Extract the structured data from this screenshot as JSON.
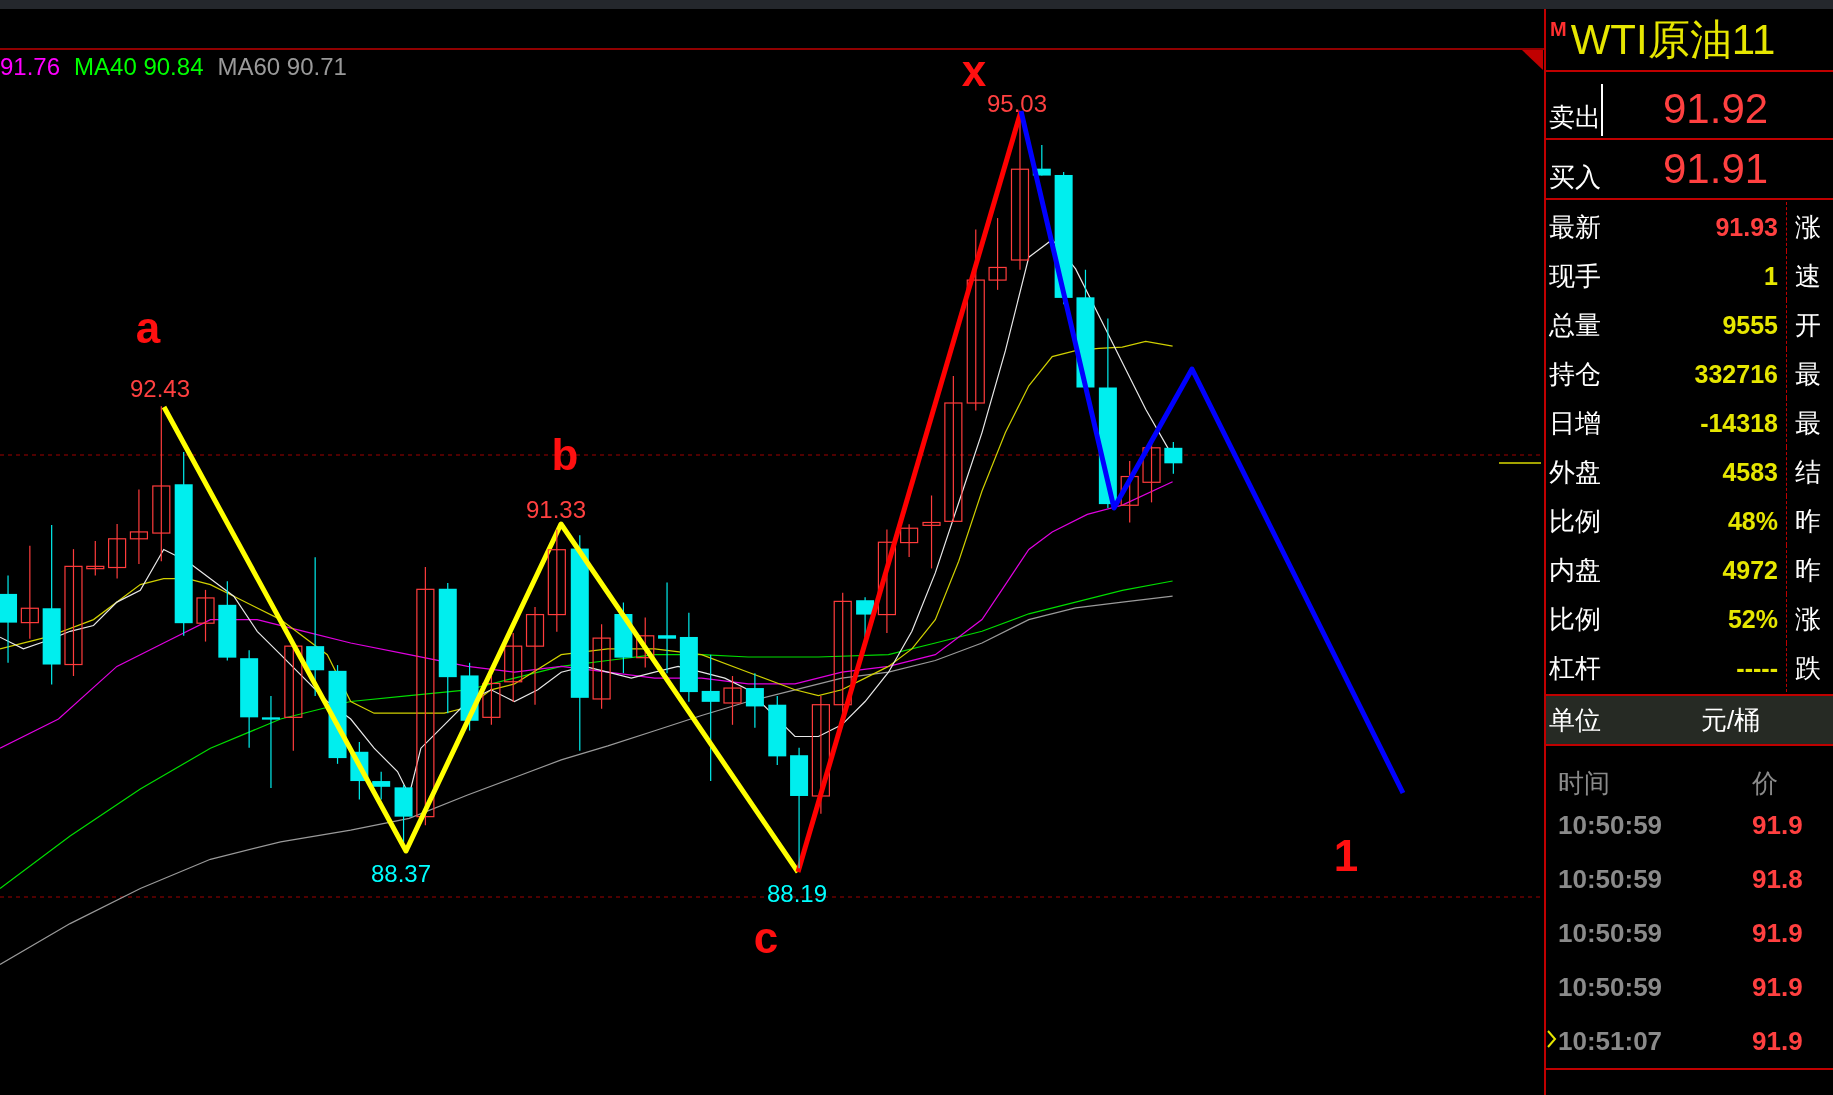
{
  "chart": {
    "ma_legend": [
      {
        "text": "91.76",
        "color": "#ff00ff"
      },
      {
        "text": "MA40 90.84",
        "color": "#00ff00"
      },
      {
        "text": "MA60 90.71",
        "color": "#9a9a9a"
      }
    ],
    "wave_labels": [
      "a",
      "b",
      "c",
      "x",
      "1"
    ],
    "price_labels": [
      {
        "text": "92.43",
        "kind": "high"
      },
      {
        "text": "88.37",
        "kind": "low"
      },
      {
        "text": "91.33",
        "kind": "high"
      },
      {
        "text": "88.19",
        "kind": "low"
      },
      {
        "text": "95.03",
        "kind": "high"
      }
    ]
  },
  "quote_panel": {
    "badge": "M",
    "title": "WTI原油11",
    "ask": {
      "label": "卖出",
      "price": "91.92"
    },
    "bid": {
      "label": "买入",
      "price": "91.91"
    },
    "stats": [
      {
        "label": "最新",
        "value": "91.93",
        "kind": "price",
        "right_label": "涨"
      },
      {
        "label": "现手",
        "value": "1",
        "kind": "count",
        "right_label": "速"
      },
      {
        "label": "总量",
        "value": "9555",
        "kind": "count",
        "right_label": "开"
      },
      {
        "label": "持仓",
        "value": "332716",
        "kind": "count",
        "right_label": "最"
      },
      {
        "label": "日增",
        "value": "-14318",
        "kind": "count",
        "right_label": "最"
      },
      {
        "label": "外盘",
        "value": "4583",
        "kind": "count",
        "right_label": "结"
      },
      {
        "label": "比例",
        "value": "48%",
        "kind": "count",
        "right_label": "昨"
      },
      {
        "label": "内盘",
        "value": "4972",
        "kind": "count",
        "right_label": "昨"
      },
      {
        "label": "比例",
        "value": "52%",
        "kind": "count",
        "right_label": "涨"
      },
      {
        "label": "杠杆",
        "value": "-----",
        "kind": "count",
        "right_label": "跌"
      }
    ],
    "unit": {
      "label": "单位",
      "value": "元/桶"
    },
    "ticks": {
      "columns": [
        "时间",
        "价"
      ],
      "rows": [
        {
          "time": "10:50:59",
          "price": "91.9",
          "latest": false
        },
        {
          "time": "10:50:59",
          "price": "91.8",
          "latest": false
        },
        {
          "time": "10:50:59",
          "price": "91.9",
          "latest": false
        },
        {
          "time": "10:50:59",
          "price": "91.9",
          "latest": false
        },
        {
          "time": "10:51:07",
          "price": "91.9",
          "latest": true
        }
      ]
    }
  }
}
